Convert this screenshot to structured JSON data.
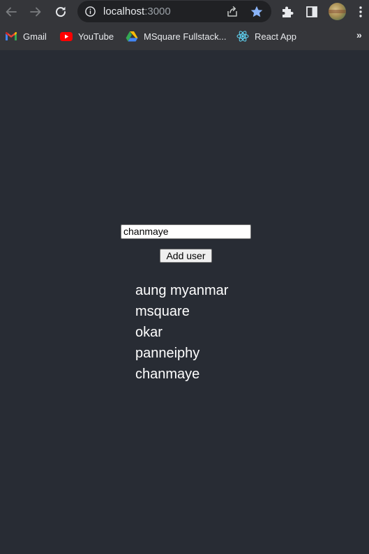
{
  "browser": {
    "url_host": "localhost",
    "url_port": ":3000",
    "icons": {
      "back": "arrow-left-icon",
      "forward": "arrow-right-icon",
      "reload": "reload-icon",
      "info": "info-icon",
      "share": "share-icon",
      "bookmark": "star-icon",
      "extensions": "puzzle-icon",
      "side_panel": "side-panel-icon",
      "menu": "kebab-menu-icon"
    },
    "accent_color": "#8ab4f8"
  },
  "bookmarks": {
    "items": [
      {
        "label": "Gmail",
        "icon": "gmail-icon"
      },
      {
        "label": "YouTube",
        "icon": "youtube-icon"
      },
      {
        "label": "MSquare Fullstack...",
        "icon": "google-drive-icon"
      },
      {
        "label": "React App",
        "icon": "react-icon"
      }
    ],
    "more_label": "»"
  },
  "app": {
    "background_color": "#282c34",
    "input_value": "chanmaye",
    "add_button_label": "Add user",
    "users": [
      "aung myanmar",
      "msquare",
      "okar",
      "panneiphy",
      "chanmaye"
    ]
  }
}
